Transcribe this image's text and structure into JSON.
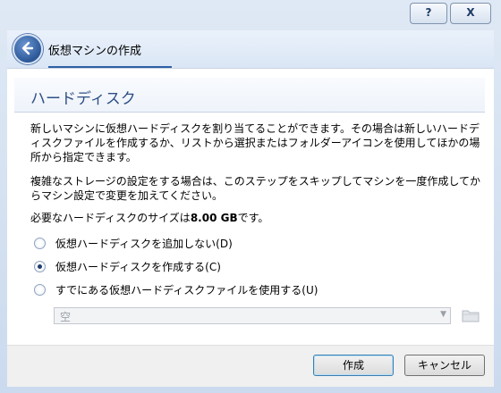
{
  "window": {
    "help_label": "?",
    "close_label": "X",
    "title": "仮想マシンの作成"
  },
  "page": {
    "title": "ハードディスク",
    "para1": "新しいマシンに仮想ハードディスクを割り当てることができます。その場合は新しいハードディスクファイルを作成するか、リストから選択またはフォルダーアイコンを使用してほかの場所から指定できます。",
    "para2": "複雑なストレージの設定をする場合は、このステップをスキップしてマシンを一度作成してからマシン設定で変更を加えてください。",
    "size_prefix": "必要なハードディスクのサイズは",
    "size_value": "8.00 GB",
    "size_suffix": "です。"
  },
  "options": [
    {
      "label": "仮想ハードディスクを追加しない(D)",
      "checked": false
    },
    {
      "label": "仮想ハードディスクを作成する(C)",
      "checked": true
    },
    {
      "label": "すでにある仮想ハードディスクファイルを使用する(U)",
      "checked": false
    }
  ],
  "disk_select": {
    "value": "空",
    "arrow": "▼"
  },
  "buttons": {
    "create": "作成",
    "cancel": "キャンセル"
  }
}
